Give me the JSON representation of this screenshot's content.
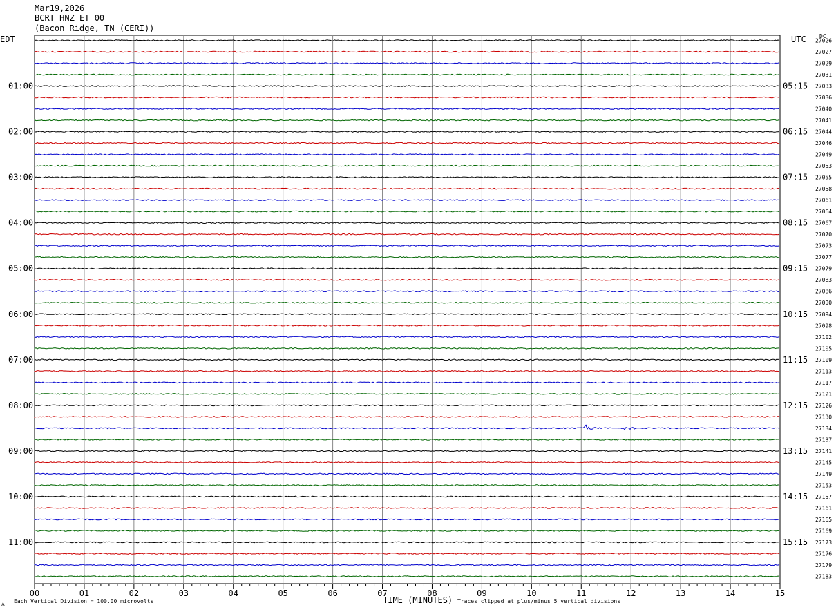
{
  "header": {
    "date": "Mar19,2026",
    "station": "BCRT HNZ ET 00",
    "location": "(Bacon Ridge, TN (CERI))"
  },
  "left_tz": "EDT",
  "right_tz": "UTC",
  "dc_label": "DC",
  "footer": {
    "scale": "Each Vertical Division =  100.00 microvolts",
    "clip": "Traces clipped at plus/minus 5 vertical divisions"
  },
  "chart_data": {
    "type": "line",
    "xlabel": "TIME (MINUTES)",
    "xlim": [
      0,
      15
    ],
    "x_ticks": [
      "00",
      "01",
      "02",
      "03",
      "04",
      "05",
      "06",
      "07",
      "08",
      "09",
      "10",
      "11",
      "12",
      "13",
      "14",
      "15"
    ],
    "trace_colors": [
      "#000000",
      "#cc0000",
      "#0000cc",
      "#006600"
    ],
    "left_hour_labels": [
      "01:00",
      "02:00",
      "03:00",
      "04:00",
      "05:00",
      "06:00",
      "07:00",
      "08:00",
      "09:00",
      "10:00",
      "11:00"
    ],
    "right_hour_labels": [
      "05:15",
      "06:15",
      "07:15",
      "08:15",
      "09:15",
      "10:15",
      "11:15",
      "12:15",
      "13:15",
      "14:15",
      "15:15"
    ],
    "dc_offsets": [
      "27026",
      "27027",
      "27029",
      "27031",
      "27033",
      "27036",
      "27040",
      "27041",
      "27044",
      "27046",
      "27049",
      "27053",
      "27055",
      "27058",
      "27061",
      "27064",
      "27067",
      "27070",
      "27073",
      "27077",
      "27079",
      "27083",
      "27086",
      "27090",
      "27094",
      "27098",
      "27102",
      "27105",
      "27109",
      "27113",
      "27117",
      "27121",
      "27126",
      "27130",
      "27134",
      "27137",
      "27141",
      "27145",
      "27149",
      "27153",
      "27157",
      "27161",
      "27165",
      "27169",
      "27173",
      "27176",
      "27179",
      "27183"
    ],
    "events": [
      {
        "trace": 34,
        "minute": 11.1,
        "amplitude": 5
      },
      {
        "trace": 34,
        "minute": 11.9,
        "amplitude": 2
      }
    ]
  }
}
